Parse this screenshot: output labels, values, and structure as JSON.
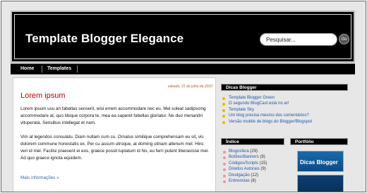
{
  "header": {
    "title": "Template Blogger Elegance",
    "search": {
      "placeholder": "Pesquisar...",
      "button_label": "Go"
    }
  },
  "nav": {
    "items": [
      "Home",
      "Templates"
    ]
  },
  "post": {
    "date": "sábado, 31 de julho de 2010",
    "title": "Lorem ipsum",
    "paragraphs": [
      "Lorem ipsum usu an fabellas senserit, wisi errem accommodare nec eu. Mel soleat sadipscing accommodare at, quo tibique corpora te, mea ea saperet fabellas gloriatur. Ne duo menandri vituperata. Sensibus intellegat et nam.",
      "Vim at legendos consulatu. Diam nullam cum cu. Ornatus similique comprehensam eu sit, vis dolorem commune honestatis ex. Per cu assum utroque, at doming utinam allenum mel. Hinc veri id mel. Facilisi praesent ei eos, graece possit luptatum id his, eu ferri putent liberavisse mei. Ad quo graece ignota equidem."
    ],
    "read_more": "Mais informações »"
  },
  "sidebar": {
    "tips": {
      "title": "Dicas Blogger",
      "items": [
        "Template Blogger Green",
        "O segundo BlogCast está no ar!",
        "Template Sky",
        "Um blog precisa mesmo dos comentários?",
        "Versão mobile de blogs do Blogger/Blogspot"
      ]
    },
    "index": {
      "title": "Índice",
      "items": [
        {
          "label": "Blogosfera",
          "count": "(29)"
        },
        {
          "label": "Botões/Banners",
          "count": "(9)"
        },
        {
          "label": "Códigos/Scripts",
          "count": "(15)"
        },
        {
          "label": "Direitos Autorais",
          "count": "(9)"
        },
        {
          "label": "Divulgação",
          "count": "(12)"
        },
        {
          "label": "Entrevistas",
          "count": "(8)"
        }
      ]
    },
    "portfolio": {
      "title": "Portfólio",
      "banner_text": "Dicas Blogger"
    }
  },
  "colors": {
    "accent_red": "#cc0000",
    "link_blue": "#2255aa",
    "tip_bullet": "#e8b800",
    "index_bullet": "#e29aa0"
  }
}
